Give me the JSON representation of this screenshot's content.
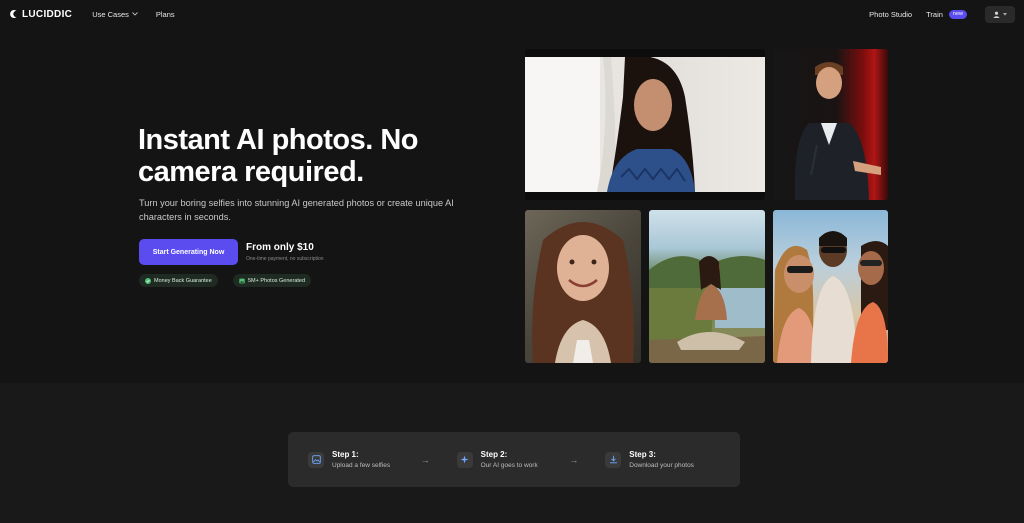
{
  "nav": {
    "logo_text": "LUCIDDIC",
    "use_cases_label": "Use Cases",
    "plans_label": "Plans",
    "photo_studio_label": "Photo Studio",
    "train_label": "Train",
    "train_badge": "new"
  },
  "hero": {
    "title": "Instant AI photos. No camera required.",
    "subtitle": "Turn your boring selfies into stunning AI generated photos or create unique AI characters in seconds.",
    "cta_label": "Start Generating Now",
    "price": "From only $10",
    "price_note": "One-time payment, no subscription",
    "badges": [
      {
        "label": "Money Back Guarantee",
        "icon": "check-circle-icon"
      },
      {
        "label": "5M+ Photos Generated",
        "icon": "image-icon"
      }
    ]
  },
  "gallery": {
    "photos": [
      {
        "subject": "woman-portrait-studio"
      },
      {
        "subject": "man-speaking-on-stage"
      },
      {
        "subject": "smiling-woman-selfie"
      },
      {
        "subject": "woman-meditating-lake"
      },
      {
        "subject": "friends-group-selfie"
      }
    ]
  },
  "steps": [
    {
      "title": "Step 1:",
      "desc": "Upload a few selfies",
      "icon": "upload-image-icon"
    },
    {
      "title": "Step 2:",
      "desc": "Our AI goes to work",
      "icon": "sparkle-icon"
    },
    {
      "title": "Step 3:",
      "desc": "Download your photos",
      "icon": "download-icon"
    }
  ],
  "arrows": [
    "→",
    "→"
  ],
  "colors": {
    "accent": "#5b4cf0",
    "background": "#141414",
    "step_panel": "#2b2b2b"
  }
}
